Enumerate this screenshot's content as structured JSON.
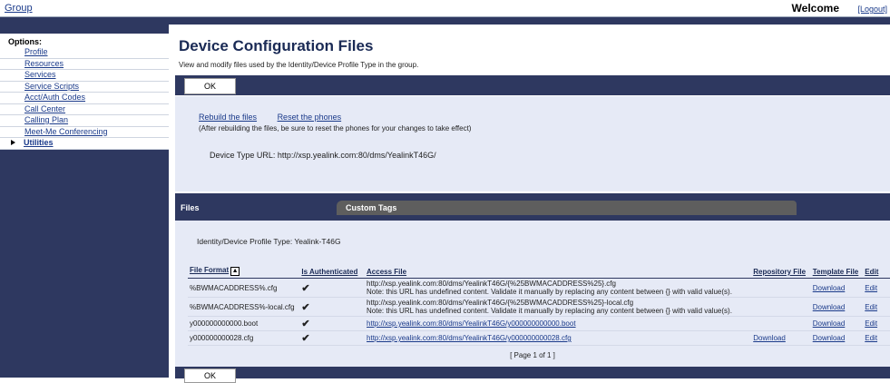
{
  "topbar": {
    "group": "Group",
    "welcome": "Welcome",
    "logout": "[Logout]"
  },
  "sidebar": {
    "title": "Options:",
    "items": [
      {
        "label": "Profile"
      },
      {
        "label": "Resources"
      },
      {
        "label": "Services"
      },
      {
        "label": "Service Scripts"
      },
      {
        "label": "Acct/Auth Codes"
      },
      {
        "label": "Call Center"
      },
      {
        "label": "Calling Plan"
      },
      {
        "label": "Meet-Me Conferencing"
      },
      {
        "label": "Utilities"
      }
    ]
  },
  "page": {
    "title": "Device Configuration Files",
    "subtitle": "View and modify files used by the Identity/Device Profile Type in the group.",
    "ok_label": "OK",
    "rebuild_link": "Rebuild the files",
    "reset_link": "Reset the phones",
    "note": "(After rebuilding the files, be sure to reset the phones for your changes to take effect)",
    "device_type_url": "Device Type URL: http://xsp.yealink.com:80/dms/YealinkT46G/"
  },
  "tabs": {
    "files": "Files",
    "custom_tags": "Custom Tags"
  },
  "files": {
    "profile_type": "Identity/Device Profile Type: Yealink-T46G",
    "headers": {
      "file_format": "File Format",
      "sort_glyph": "▲",
      "is_authenticated": "Is Authenticated",
      "access_file": "Access File",
      "repository_file": "Repository File",
      "template_file": "Template File",
      "edit": "Edit"
    },
    "rows": [
      {
        "format": "%BWMACADDRESS%.cfg",
        "auth": "✔",
        "access_url": "http://xsp.yealink.com:80/dms/YealinkT46G/{%25BWMACADDRESS%25}.cfg",
        "access_note": "Note: this URL has undefined content. Validate it manually by replacing any content between {} with valid value(s).",
        "repo": "",
        "template": "Download",
        "edit": "Edit"
      },
      {
        "format": "%BWMACADDRESS%-local.cfg",
        "auth": "✔",
        "access_url": "http://xsp.yealink.com:80/dms/YealinkT46G/{%25BWMACADDRESS%25}-local.cfg",
        "access_note": "Note: this URL has undefined content. Validate it manually by replacing any content between {} with valid value(s).",
        "repo": "",
        "template": "Download",
        "edit": "Edit"
      },
      {
        "format": "y000000000000.boot",
        "auth": "✔",
        "access_url": "http://xsp.yealink.com:80/dms/YealinkT46G/y000000000000.boot",
        "access_note": "",
        "repo": "",
        "template": "Download",
        "edit": "Edit"
      },
      {
        "format": "y000000000028.cfg",
        "auth": "✔",
        "access_url": "http://xsp.yealink.com:80/dms/YealinkT46G/y000000000028.cfg",
        "access_note": "",
        "repo": "Download",
        "template": "Download",
        "edit": "Edit"
      }
    ],
    "pager": "[ Page 1 of 1 ]"
  }
}
